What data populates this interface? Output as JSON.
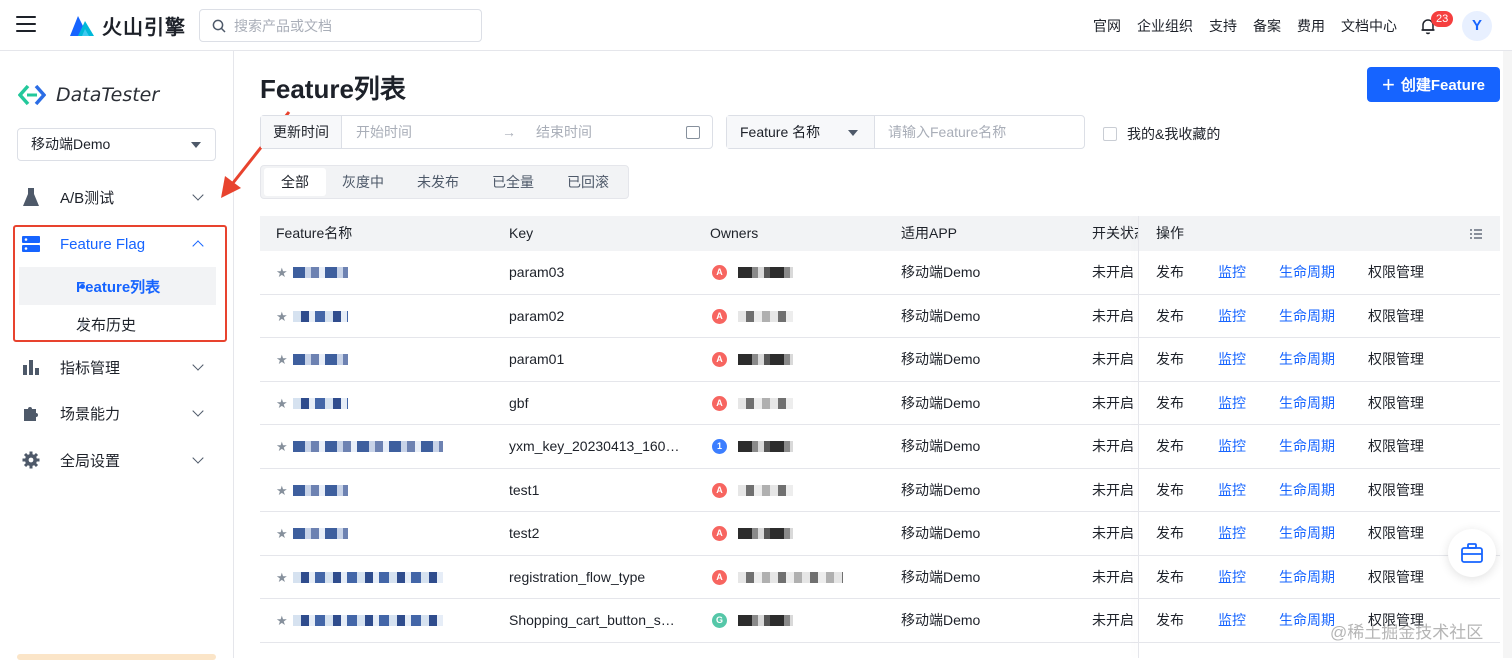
{
  "topbar": {
    "brand": "火山引擎",
    "search_placeholder": "搜索产品或文档",
    "nav": [
      "官网",
      "企业组织",
      "支持",
      "备案",
      "费用",
      "文档中心"
    ],
    "notification_count": "23",
    "user_initial": "Y"
  },
  "sidebar": {
    "product_name": "DataTester",
    "app_select": "移动端Demo",
    "menu": [
      {
        "label": "A/B测试",
        "icon": "flask-icon"
      },
      {
        "label": "Feature Flag",
        "icon": "feature-flag-icon"
      },
      {
        "label": "指标管理",
        "icon": "bar-chart-icon"
      },
      {
        "label": "场景能力",
        "icon": "puzzle-icon"
      },
      {
        "label": "全局设置",
        "icon": "gear-icon"
      }
    ],
    "sub_items": [
      "Feature列表",
      "发布历史"
    ]
  },
  "main": {
    "title": "Feature列表",
    "create_button": "创建Feature",
    "date_filter": {
      "label": "更新时间",
      "start_placeholder": "开始时间",
      "end_placeholder": "结束时间"
    },
    "name_filter": {
      "select": "Feature 名称",
      "placeholder": "请输入Feature名称"
    },
    "favorites_label": "我的&我收藏的",
    "tabs": [
      "全部",
      "灰度中",
      "未发布",
      "已全量",
      "已回滚"
    ],
    "table": {
      "columns": [
        "Feature名称",
        "Key",
        "Owners",
        "适用APP",
        "开关状态",
        "操作"
      ],
      "rows": [
        {
          "key": "param03",
          "owner_initial": "A",
          "app": "移动端Demo",
          "status": "未开启"
        },
        {
          "key": "param02",
          "owner_initial": "A",
          "app": "移动端Demo",
          "status": "未开启"
        },
        {
          "key": "param01",
          "owner_initial": "A",
          "app": "移动端Demo",
          "status": "未开启"
        },
        {
          "key": "gbf",
          "owner_initial": "A",
          "app": "移动端Demo",
          "status": "未开启"
        },
        {
          "key": "yxm_key_20230413_160…",
          "owner_initial": "1",
          "app": "移动端Demo",
          "status": "未开启"
        },
        {
          "key": "test1",
          "owner_initial": "A",
          "app": "移动端Demo",
          "status": "未开启"
        },
        {
          "key": "test2",
          "owner_initial": "A",
          "app": "移动端Demo",
          "status": "未开启"
        },
        {
          "key": "registration_flow_type",
          "owner_initial": "A",
          "app": "移动端Demo",
          "status": "未开启"
        },
        {
          "key": "Shopping_cart_button_s…",
          "owner_initial": "G",
          "app": "移动端Demo",
          "status": "未开启"
        }
      ],
      "actions": [
        "发布",
        "监控",
        "生命周期",
        "权限管理"
      ]
    }
  },
  "watermark": "@稀土掘金技术社区",
  "colors": {
    "accent": "#1664ff",
    "highlight_box": "#e8432e"
  }
}
